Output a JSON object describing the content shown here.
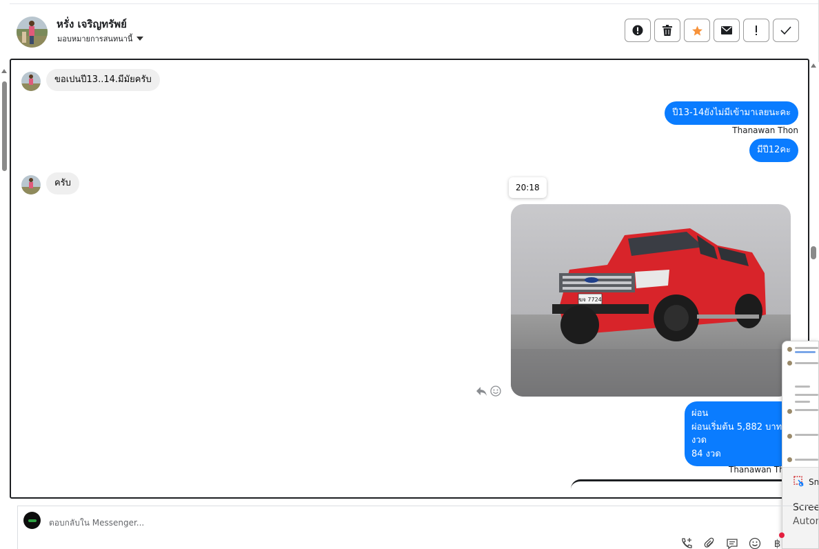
{
  "header": {
    "contact_name": "หรั่ง เจริญทรัพย์",
    "assign_label": "มอบหมายการสนทนานี้",
    "actions": [
      {
        "name": "spam-icon",
        "label": "!"
      },
      {
        "name": "trash-icon",
        "label": ""
      },
      {
        "name": "star-icon",
        "label": ""
      },
      {
        "name": "envelope-icon",
        "label": ""
      },
      {
        "name": "exclamation-icon",
        "label": "!"
      },
      {
        "name": "check-icon",
        "label": ""
      }
    ],
    "star_color": "#f7923a"
  },
  "messages": {
    "in_1": "ขอเปนปี13..14.มีมัยครับ",
    "out_1": "ปี13-14ยังไม่มีเข้ามาเลยนะคะ",
    "sender_1": "Thanawan Thon",
    "out_2": "มีปี12คะ",
    "in_2": "ครับ",
    "time": "20:18",
    "photo_plate": "ฆจ 7724",
    "out_3_lines": [
      "ผ่อน",
      "ผ่อนเริ่มต้น 5,882 บาท",
      "งวด",
      "84 งวด"
    ],
    "sender_2": "Thanawan Thon"
  },
  "overlay": {
    "snip_title": "Snip",
    "line1": "Screen",
    "line2": "Autom"
  },
  "composer": {
    "placeholder": "ตอบกลับใน Messenger...",
    "currency_symbol": "฿"
  },
  "colors": {
    "outgoing_bubble": "#0a7cff",
    "incoming_bubble": "#efefef",
    "truck": "#d8242a"
  }
}
